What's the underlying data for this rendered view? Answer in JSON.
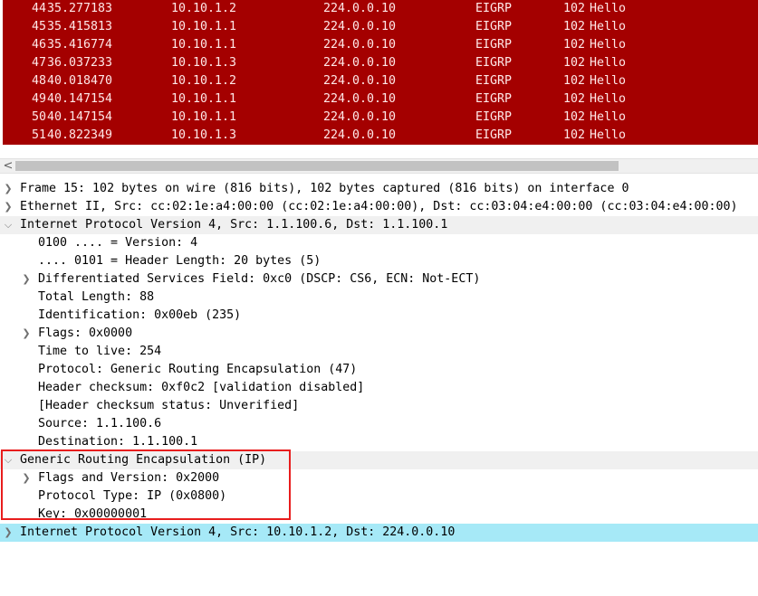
{
  "packet_list": {
    "rows": [
      {
        "no": "44",
        "time": "35.277183",
        "source": "10.10.1.2",
        "destination": "224.0.0.10",
        "protocol": "EIGRP",
        "length": "102",
        "info": "Hello"
      },
      {
        "no": "45",
        "time": "35.415813",
        "source": "10.10.1.1",
        "destination": "224.0.0.10",
        "protocol": "EIGRP",
        "length": "102",
        "info": "Hello"
      },
      {
        "no": "46",
        "time": "35.416774",
        "source": "10.10.1.1",
        "destination": "224.0.0.10",
        "protocol": "EIGRP",
        "length": "102",
        "info": "Hello"
      },
      {
        "no": "47",
        "time": "36.037233",
        "source": "10.10.1.3",
        "destination": "224.0.0.10",
        "protocol": "EIGRP",
        "length": "102",
        "info": "Hello"
      },
      {
        "no": "48",
        "time": "40.018470",
        "source": "10.10.1.2",
        "destination": "224.0.0.10",
        "protocol": "EIGRP",
        "length": "102",
        "info": "Hello"
      },
      {
        "no": "49",
        "time": "40.147154",
        "source": "10.10.1.1",
        "destination": "224.0.0.10",
        "protocol": "EIGRP",
        "length": "102",
        "info": "Hello"
      },
      {
        "no": "50",
        "time": "40.147154",
        "source": "10.10.1.1",
        "destination": "224.0.0.10",
        "protocol": "EIGRP",
        "length": "102",
        "info": "Hello"
      },
      {
        "no": "51",
        "time": "40.822349",
        "source": "10.10.1.3",
        "destination": "224.0.0.10",
        "protocol": "EIGRP",
        "length": "102",
        "info": "Hello"
      }
    ],
    "row_color": "#a40000"
  },
  "scrollbar": {
    "left_arrow": "<"
  },
  "details": {
    "frame": "Frame 15: 102 bytes on wire (816 bits), 102 bytes captured (816 bits) on interface 0",
    "ethernet": "Ethernet II, Src: cc:02:1e:a4:00:00 (cc:02:1e:a4:00:00), Dst: cc:03:04:e4:00:00 (cc:03:04:e4:00:00)",
    "ipv4_outer": {
      "header": "Internet Protocol Version 4, Src: 1.1.100.6, Dst: 1.1.100.1",
      "version": "0100 .... = Version: 4",
      "header_length": ".... 0101 = Header Length: 20 bytes (5)",
      "dsfield": "Differentiated Services Field: 0xc0 (DSCP: CS6, ECN: Not-ECT)",
      "total_length": "Total Length: 88",
      "identification": "Identification: 0x00eb (235)",
      "flags": "Flags: 0x0000",
      "ttl": "Time to live: 254",
      "protocol": "Protocol: Generic Routing Encapsulation (47)",
      "checksum": "Header checksum: 0xf0c2 [validation disabled]",
      "checksum_status": "[Header checksum status: Unverified]",
      "source": "Source: 1.1.100.6",
      "destination": "Destination: 1.1.100.1"
    },
    "gre": {
      "header": "Generic Routing Encapsulation (IP)",
      "flags_version": "Flags and Version: 0x2000",
      "protocol_type": "Protocol Type: IP (0x0800)",
      "key": "Key: 0x00000001"
    },
    "ipv4_inner": "Internet Protocol Version 4, Src: 10.10.1.2, Dst: 224.0.0.10"
  },
  "icons": {
    "collapsed": "chevron-right-icon",
    "expanded": "chevron-down-icon"
  },
  "highlight_color": "#e81d1d",
  "selected_row_color": "#a6e9f7"
}
